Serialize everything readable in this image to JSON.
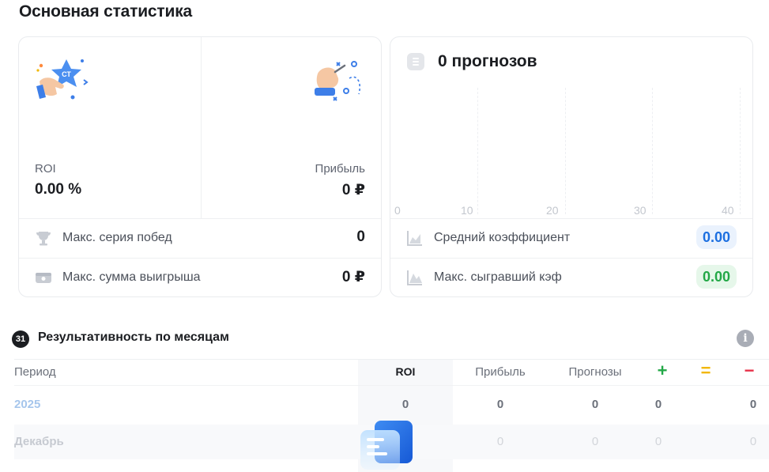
{
  "page": {
    "title": "Основная статистика"
  },
  "stats": {
    "roi": {
      "label": "ROI",
      "value": "0.00 %"
    },
    "profit": {
      "label": "Прибыль",
      "value": "0 ₽"
    },
    "rows": [
      {
        "icon": "trophy-icon",
        "label": "Макс. серия побед",
        "value": "0"
      },
      {
        "icon": "wallet-icon",
        "label": "Макс. сумма выигрыша",
        "value": "0 ₽"
      }
    ]
  },
  "forecasts_card": {
    "icon": "document-icon",
    "title": "0 прогнозов",
    "axis_ticks": [
      "0",
      "10",
      "20",
      "30",
      "40"
    ],
    "rows": [
      {
        "icon": "area-chart-icon",
        "label": "Средний коэффициент",
        "value": "0.00",
        "color": "#1d6fe0"
      },
      {
        "icon": "mountain-chart-icon",
        "label": "Макс. сыгравший кэф",
        "value": "0.00",
        "color": "#23a847"
      }
    ]
  },
  "monthly": {
    "badge": "31",
    "title": "Результативность по месяцам",
    "info_icon": "info-icon",
    "headers": {
      "period": "Период",
      "roi": "ROI",
      "profit": "Прибыль",
      "forecasts": "Прогнозы",
      "wins": "+",
      "draws": "=",
      "losses": "−"
    },
    "header_colors": {
      "wins": "#23a847",
      "draws": "#f2b705",
      "losses": "#e8334a"
    },
    "rows": [
      {
        "period": "2025",
        "roi": "0",
        "profit": "0",
        "forecasts": "0",
        "wins": "0",
        "draws": "",
        "losses": "0"
      },
      {
        "period": "Декабрь",
        "roi": "",
        "profit": "0",
        "forecasts": "0",
        "wins": "0",
        "draws": "",
        "losses": "0"
      }
    ]
  }
}
